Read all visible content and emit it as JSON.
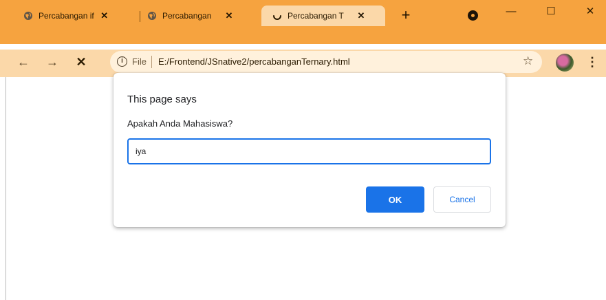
{
  "browser": {
    "tabs": [
      {
        "title": "Percabangan if",
        "close": "✕"
      },
      {
        "title": "Percabangan",
        "close": "✕"
      },
      {
        "title": "Percabangan T",
        "close": "✕"
      }
    ],
    "new_tab": "+",
    "window_controls": {
      "minimize": "—",
      "maximize": "☐",
      "close": "✕"
    },
    "toolbar": {
      "back": "←",
      "forward": "→",
      "stop": "✕",
      "info_icon": "ⓘ",
      "scheme_label": "File",
      "url": "E:/Frontend/JSnative2/percabanganTernary.html",
      "star": "☆",
      "menu": "⋮"
    },
    "colors": {
      "frame": "#f6a33f",
      "toolbar": "#fbd8a9",
      "accent": "#1a73e8"
    }
  },
  "dialog": {
    "title": "This page says",
    "message": "Apakah Anda Mahasiswa?",
    "input_value": "iya",
    "ok_label": "OK",
    "cancel_label": "Cancel"
  }
}
